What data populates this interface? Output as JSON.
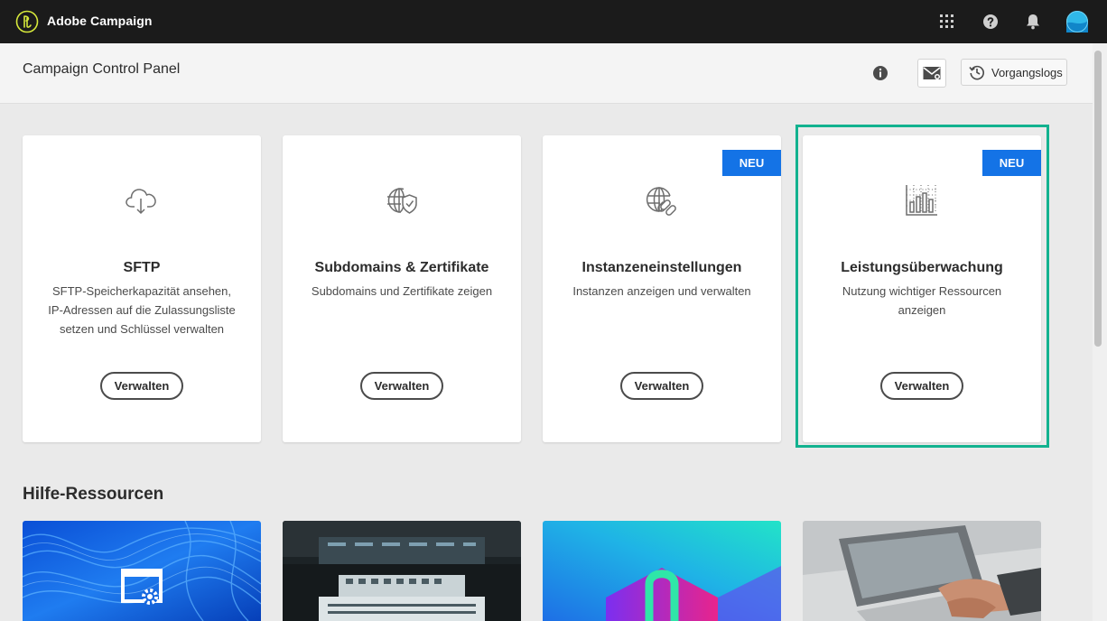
{
  "app": {
    "name": "Adobe Campaign"
  },
  "topbar": {
    "icons": [
      "apps-grid-icon",
      "help-icon",
      "bell-icon",
      "user-avatar"
    ]
  },
  "header": {
    "title": "Campaign Control Panel",
    "logs_label": "Vorgangslogs"
  },
  "cards": [
    {
      "title": "SFTP",
      "description": "SFTP-Speicherkapazität ansehen, IP-Adressen auf die Zulassungsliste setzen und Schlüssel verwalten",
      "button": "Verwalten",
      "badge": "",
      "icon": "cloud-download-icon"
    },
    {
      "title": "Subdomains & Zertifikate",
      "description": "Subdomains und Zertifikate zeigen",
      "button": "Verwalten",
      "badge": "",
      "icon": "globe-shield-icon"
    },
    {
      "title": "Instanzeneinstellungen",
      "description": "Instanzen anzeigen und verwalten",
      "button": "Verwalten",
      "badge": "NEU",
      "icon": "globe-link-icon"
    },
    {
      "title": "Leistungsüberwachung",
      "description": "Nutzung wichtiger Ressourcen anzeigen",
      "button": "Verwalten",
      "badge": "NEU",
      "icon": "bar-chart-icon"
    }
  ],
  "help": {
    "title": "Hilfe-Ressourcen",
    "resources": [
      "blue-abstract-settings-thumbnail",
      "control-room-thumbnail",
      "gradient-logo-thumbnail",
      "laptop-typing-thumbnail"
    ]
  },
  "colors": {
    "accent": "#1473e6",
    "highlight": "#12b28f",
    "topbar": "#1b1b1b"
  }
}
